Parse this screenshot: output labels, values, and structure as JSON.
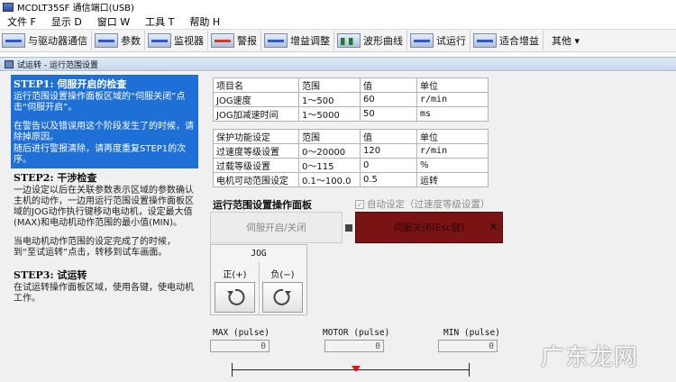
{
  "app": {
    "title": "MCDLT35SF  通信端口(USB)"
  },
  "menu": [
    "文件 F",
    "显示 D",
    "窗口 W",
    "工具 T",
    "帮助 H"
  ],
  "toolbar": {
    "items": [
      "与驱动器通信",
      "参数",
      "监视器",
      "警报",
      "增益调整",
      "波形曲线",
      "试运行",
      "适合增益"
    ],
    "more": "其他 ▾"
  },
  "window": {
    "title": "试运转 - 运行范围设置"
  },
  "guide": {
    "step1_title": "STEP1: 伺服开启的检查",
    "step1_text1": "运行范围设置操作面板区域的“伺服关闭”点击“伺服开启”。",
    "step1_text2": "在警告以及错误用这个阶段发生了的时候，请除掉原因。",
    "step1_text3": "随后进行警报清除，请再度重复STEP1的次序。",
    "step2_title": "STEP2: 干涉检查",
    "step2_text1": "一边设定以后在关联参数表示区域的参数确认主机的动作，一边用运行范围设置操作面板区域的JOG动作执行键移动电动机，设定最大值(MAX)和电动机动作范围的最小值(MIN)。",
    "step2_text2": "当电动机动作范围的设定完成了的时候，到“至试运转”点击，转移到试车画面。",
    "step3_title": "STEP3: 试运转",
    "step3_text": "在试运转操作面板区域，使用各键，使电动机工作。"
  },
  "params_table": {
    "header": [
      "项目名",
      "范围",
      "值",
      "单位"
    ],
    "rows": [
      [
        "JOG速度",
        "1～500",
        "60",
        "r/min"
      ],
      [
        "JOG加减速时间",
        "1～5000",
        "50",
        "ms"
      ]
    ]
  },
  "protect_table": {
    "header": [
      "保护功能设定",
      "范围",
      "值",
      "单位"
    ],
    "rows": [
      [
        "过速度等级设置",
        "0～20000",
        "120",
        "r/min"
      ],
      [
        "过载等级设置",
        "0～115",
        "0",
        "%"
      ],
      [
        "电机可动范围设定",
        "0.1～100.0",
        "0.5",
        "运转"
      ]
    ]
  },
  "panel": {
    "title": "运行范围设置操作面板",
    "auto_set": "自动设定（过速度等级设置）",
    "servo_on": "伺服开启/关闭",
    "servo_off": "伺服关闭(Esc键)",
    "servo_off_close": "✕"
  },
  "jog": {
    "title": "JOG",
    "pos": "正(+)",
    "neg": "负(−)"
  },
  "pulse": {
    "max_label": "MAX (pulse)",
    "max_value": "0",
    "motor_label": "MOTOR (pulse)",
    "motor_value": "0",
    "min_label": "MIN (pulse)",
    "min_value": "0"
  },
  "watermark": "广东龙网"
}
